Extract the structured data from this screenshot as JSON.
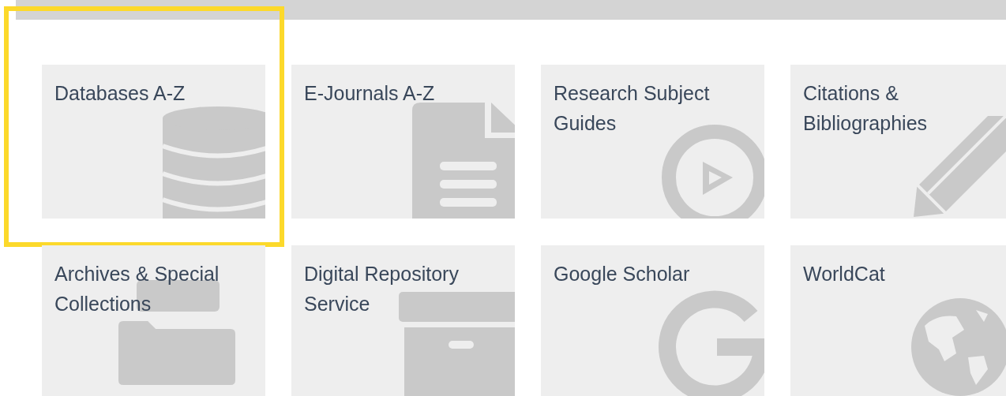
{
  "tiles": [
    {
      "title": "Databases A-Z",
      "highlighted": true
    },
    {
      "title": "E-Journals A-Z",
      "highlighted": false
    },
    {
      "title": "Research Subject Guides",
      "highlighted": false
    },
    {
      "title": "Citations & Bibliographies",
      "highlighted": false
    },
    {
      "title": "Archives & Special Collections",
      "highlighted": false
    },
    {
      "title": "Digital Repository Service",
      "highlighted": false
    },
    {
      "title": "Google Scholar",
      "highlighted": false
    },
    {
      "title": "WorldCat",
      "highlighted": false
    }
  ]
}
